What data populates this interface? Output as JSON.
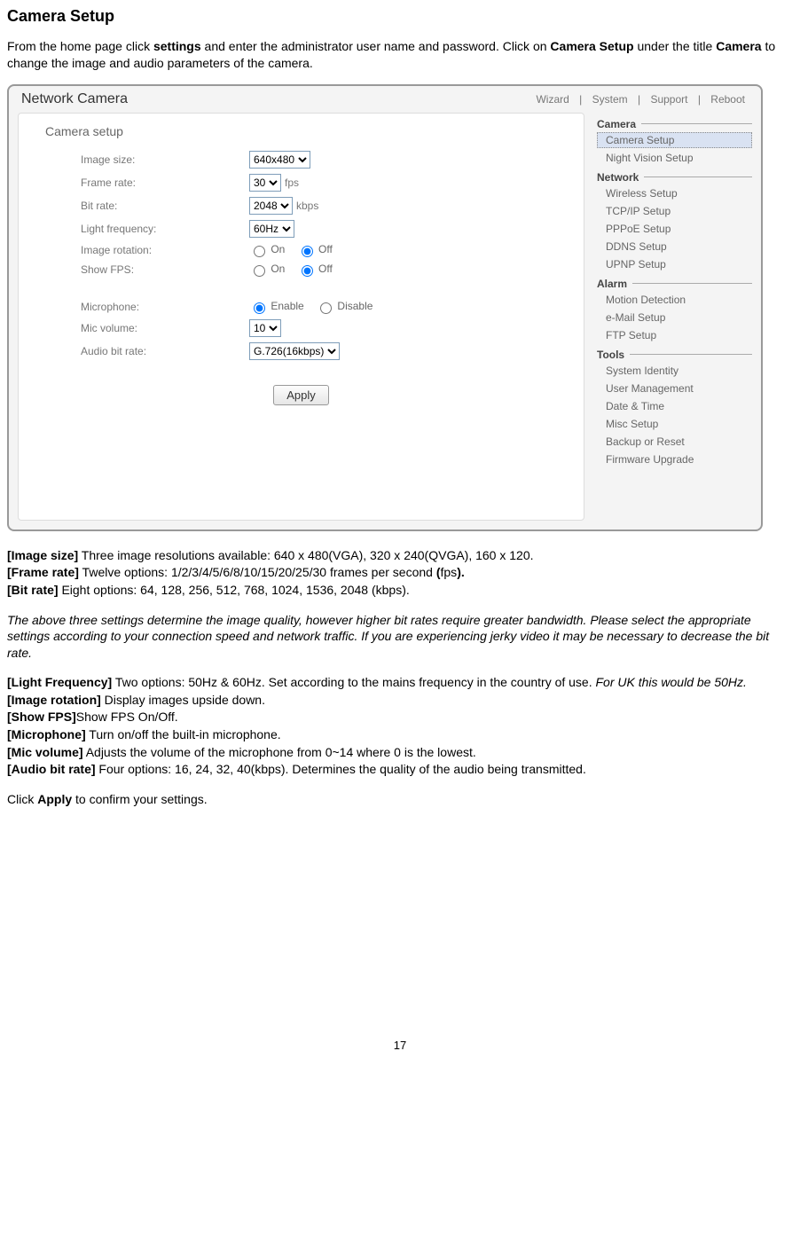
{
  "title": "Camera Setup",
  "intro": {
    "p1a": "From the home page click ",
    "p1b": "settings",
    "p1c": " and enter the administrator user name and password. Click on ",
    "p1d": "Camera Setup",
    "p1e": " under the title ",
    "p1f": "Camera",
    "p1g": " to change the image and audio parameters of the camera."
  },
  "shot": {
    "brand": "Network Camera",
    "toplinks": {
      "wizard": "Wizard",
      "system": "System",
      "support": "Support",
      "reboot": "Reboot",
      "sep": "|"
    },
    "section_title": "Camera setup",
    "rows": {
      "image_size": {
        "label": "Image size:",
        "value": "640x480"
      },
      "frame_rate": {
        "label": "Frame rate:",
        "value": "30",
        "suffix": "fps"
      },
      "bit_rate": {
        "label": "Bit rate:",
        "value": "2048",
        "suffix": "kbps"
      },
      "light_freq": {
        "label": "Light frequency:",
        "value": "60Hz"
      },
      "image_rot": {
        "label": "Image rotation:",
        "on": "On",
        "off": "Off",
        "checked": "off"
      },
      "show_fps": {
        "label": "Show FPS:",
        "on": "On",
        "off": "Off",
        "checked": "off"
      },
      "microphone": {
        "label": "Microphone:",
        "enable": "Enable",
        "disable": "Disable",
        "checked": "enable"
      },
      "mic_volume": {
        "label": "Mic volume:",
        "value": "10"
      },
      "audio_bit": {
        "label": "Audio bit rate:",
        "value": "G.726(16kbps)"
      }
    },
    "apply": "Apply",
    "sidebar": {
      "camera": {
        "title": "Camera",
        "items": [
          "Camera Setup",
          "Night Vision Setup"
        ]
      },
      "network": {
        "title": "Network",
        "items": [
          "Wireless Setup",
          "TCP/IP Setup",
          "PPPoE Setup",
          "DDNS Setup",
          "UPNP Setup"
        ]
      },
      "alarm": {
        "title": "Alarm",
        "items": [
          "Motion Detection",
          "e-Mail Setup",
          "FTP Setup"
        ]
      },
      "tools": {
        "title": "Tools",
        "items": [
          "System Identity",
          "User Management",
          "Date & Time",
          "Misc Setup",
          "Backup or Reset",
          "Firmware Upgrade"
        ]
      }
    }
  },
  "desc": {
    "image_size": {
      "h": "[Image size]",
      "t": " Three image resolutions available: 640 x 480(VGA), 320 x 240(QVGA), 160 x 120."
    },
    "frame_rate": {
      "h": "[Frame rate]",
      "t1": " Twelve options: 1/2/3/4/5/6/8/10/15/20/25/30 frames per second ",
      "t2": "(",
      "t3": "fps",
      "t4": ")."
    },
    "bit_rate": {
      "h": "[Bit rate]",
      "t": " Eight options: 64, 128, 256, 512, 768, 1024, 1536, 2048 (kbps)."
    },
    "qual_note": "The above three settings determine the image quality, however higher bit rates require greater bandwidth. Please select the appropriate settings according to your connection speed and network traffic. If you are experiencing jerky video it may be necessary to decrease the bit rate.",
    "light_freq": {
      "h": "[Light Frequency]",
      "t": " Two options: 50Hz & 60Hz. Set according to the mains frequency in the country of use. ",
      "note": "For UK this would be 50Hz."
    },
    "image_rot": {
      "h": "[Image rotation]",
      "t": " Display images upside down."
    },
    "show_fps": {
      "h": "[Show FPS]",
      "t": "Show FPS On/Off."
    },
    "microphone": {
      "h": "[Microphone]",
      "t": " Turn on/off the built-in microphone."
    },
    "mic_volume": {
      "h": "[Mic volume]",
      "t": " Adjusts the volume of the microphone from 0~14 where 0 is the lowest."
    },
    "audio_bit": {
      "h": "[Audio bit rate]",
      "t": " Four options: 16, 24, 32, 40(kbps). Determines the quality of the audio being transmitted."
    },
    "apply_line": {
      "a": "Click ",
      "b": "Apply",
      "c": " to confirm your settings."
    }
  },
  "page_number": "17"
}
